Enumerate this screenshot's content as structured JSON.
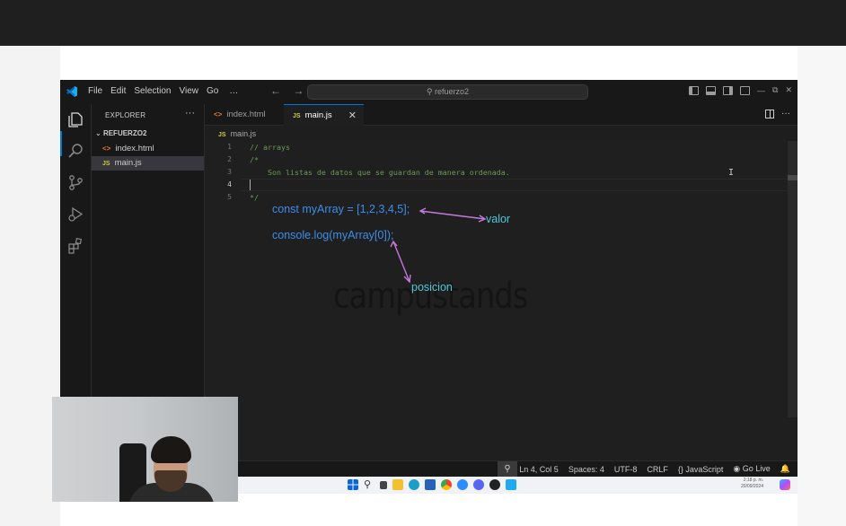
{
  "titlebar": {
    "menu": [
      "File",
      "Edit",
      "Selection",
      "View",
      "Go",
      "…"
    ],
    "search": "refuerzo2"
  },
  "sidebar": {
    "header": "EXPLORER",
    "folder": "REFUERZO2",
    "files": [
      {
        "name": "index.html",
        "icon": "html-file-icon"
      },
      {
        "name": "main.js",
        "icon": "js-file-icon",
        "selected": true
      }
    ]
  },
  "tabs": [
    {
      "label": "index.html",
      "icon": "html-file-icon",
      "active": false
    },
    {
      "label": "main.js",
      "icon": "js-file-icon",
      "active": true
    }
  ],
  "breadcrumb": {
    "icon_text": "JS",
    "file": "main.js"
  },
  "editor": {
    "line_numbers": [
      "1",
      "2",
      "3",
      "4",
      "5"
    ],
    "current_line": "4",
    "lines": [
      "// arrays",
      "/*",
      "    Son listas de datos que se guardan de manera ordenada.",
      "",
      "*/"
    ]
  },
  "annotations": {
    "line1": "const myArray = [1,2,3,4,5];",
    "line2": "console.log(myArray[0]);",
    "label_valor": "valor",
    "label_posicion": "posicion",
    "code_color": "#3b8eea",
    "label_color": "#4ec9d8",
    "arrow_color": "#c678dd"
  },
  "watermark": "campustands",
  "statusbar": {
    "position": "Ln 4, Col 5",
    "spaces": "Spaces: 4",
    "encoding": "UTF-8",
    "eol": "CRLF",
    "language": "{} JavaScript",
    "golive": "Go Live"
  },
  "taskbar": {
    "time": "2:18 p. m.",
    "date": "20/09/2024"
  },
  "colors": {
    "accent": "#0078d4",
    "editor_bg": "#1f1f1f",
    "comment": "#6a9955"
  }
}
